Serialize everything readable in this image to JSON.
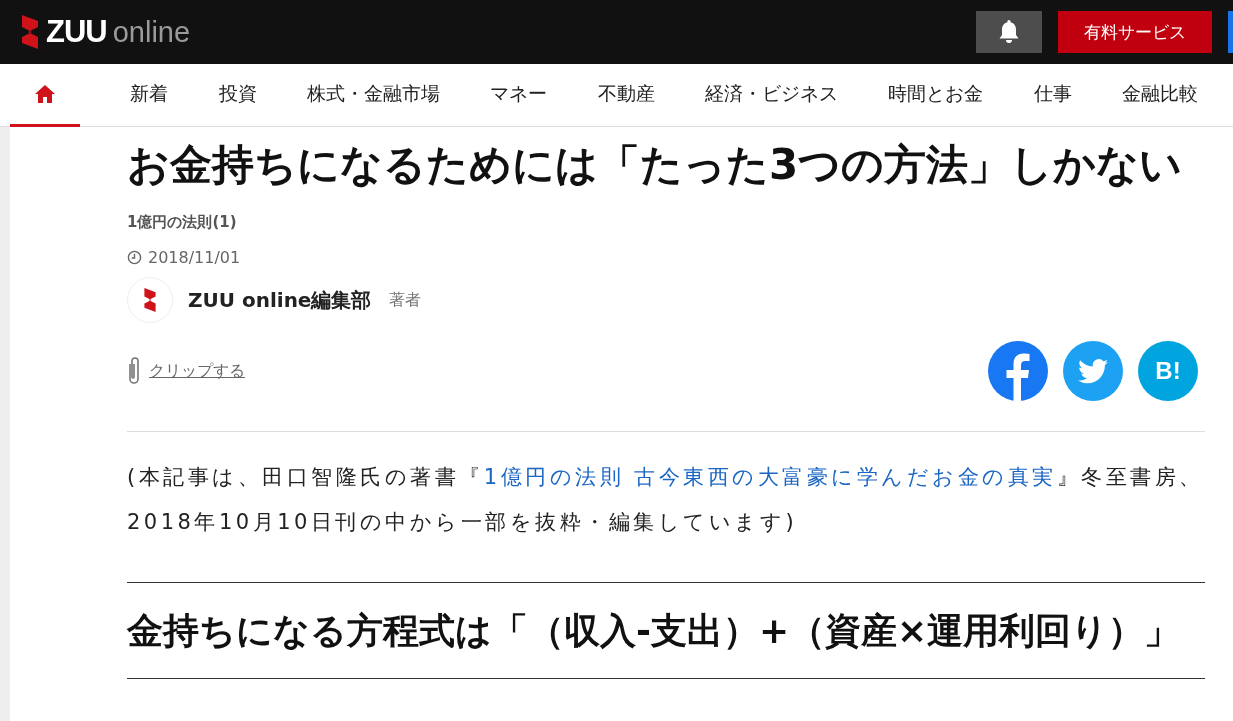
{
  "header": {
    "logo": {
      "brand": "ZUU",
      "suffix": "online"
    },
    "notification_button": {
      "kind": "bell"
    },
    "paid_service_button": "有料サービス"
  },
  "nav": [
    {
      "kind": "home",
      "selected": true
    },
    {
      "kind": "text",
      "label": "新着",
      "selected": false
    },
    {
      "kind": "text",
      "label": "投資",
      "selected": false
    },
    {
      "kind": "text",
      "label": "株式・金融市場",
      "selected": false
    },
    {
      "kind": "text",
      "label": "マネー",
      "selected": false
    },
    {
      "kind": "text",
      "label": "不動産",
      "selected": false
    },
    {
      "kind": "text",
      "label": "経済・ビジネス",
      "selected": false
    },
    {
      "kind": "text",
      "label": "時間とお金",
      "selected": false
    },
    {
      "kind": "text",
      "label": "仕事",
      "selected": false
    },
    {
      "kind": "text",
      "label": "金融比較",
      "selected": false
    }
  ],
  "article": {
    "title": "お金持ちになるためには「たった3つの方法」しかない",
    "series": "1億円の法則(1)",
    "date": "2018/11/01",
    "author": {
      "name": "ZUU online編集部",
      "role": "著者"
    },
    "clip": "クリップする",
    "share": [
      {
        "kind": "facebook"
      },
      {
        "kind": "twitter"
      },
      {
        "kind": "hatena",
        "label": "B!"
      }
    ],
    "intro": {
      "before": "(本記事は、田口智隆氏の著書『",
      "link": "1億円の法則 古今東西の大富豪に学んだお金の真実",
      "after": "』冬至書房、2018年10月10日刊の中から一部を抜粋・編集しています)"
    },
    "heading": "金持ちになる方程式は「（収入-支出）+（資産×運用利回り）」"
  }
}
